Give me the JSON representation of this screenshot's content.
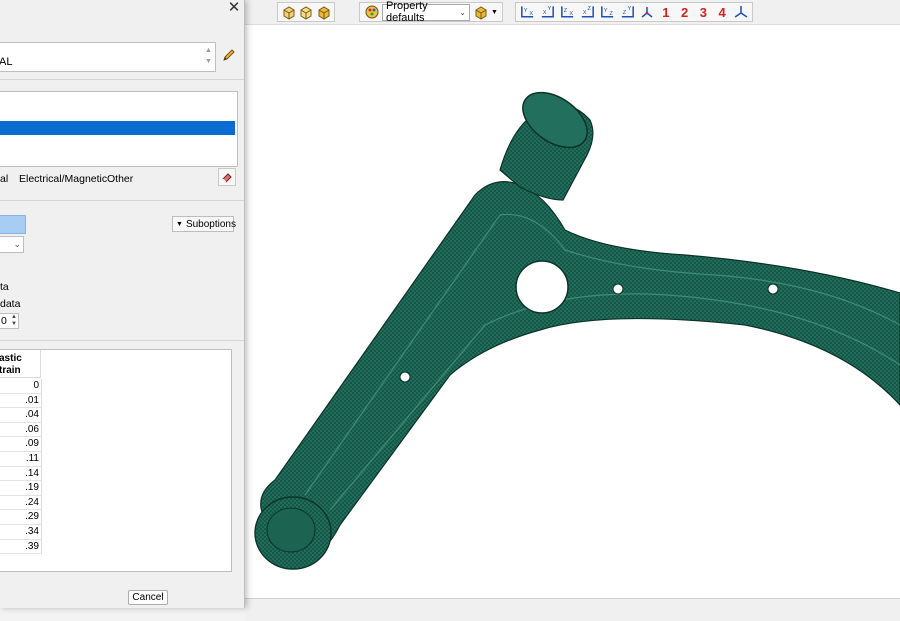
{
  "toolbar": {
    "property_combo": "Property defaults",
    "view_numbers": [
      "1",
      "2",
      "3",
      "4"
    ]
  },
  "dialog": {
    "name_value": "AL",
    "menu_items": [
      "al",
      "Electrical/Magnetic",
      "Other"
    ],
    "suboptions_label": "Suboptions",
    "option1_label": "ta",
    "option2_label": "data",
    "spin_value": "0",
    "table": {
      "header": [
        "astic",
        "train"
      ],
      "rows": [
        "0",
        ".01",
        ".04",
        ".06",
        ".09",
        ".11",
        ".14",
        ".19",
        ".24",
        ".29",
        ".34",
        ".39"
      ]
    },
    "cancel_label": "Cancel"
  },
  "colors": {
    "mesh": "#1f6e5c",
    "selection": "#0a6bd2",
    "highlight_field": "#a8cdf4"
  }
}
